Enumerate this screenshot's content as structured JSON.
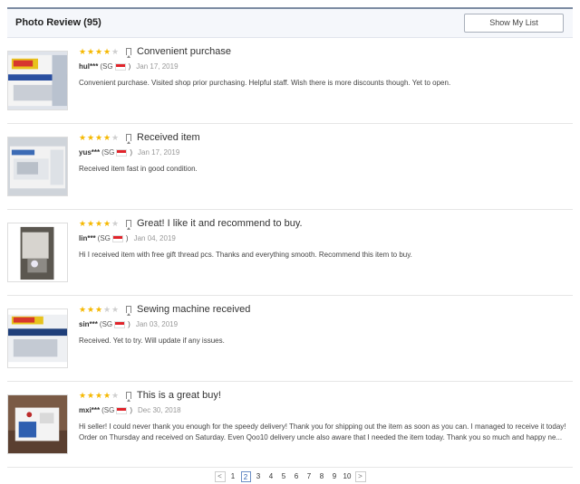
{
  "header": {
    "title": "Photo Review (95)",
    "show_list_label": "Show My List"
  },
  "reviews": [
    {
      "rating": 4,
      "title": "Convenient purchase",
      "user": "hul***",
      "country": "(SG",
      "date": "Jan 17, 2019",
      "text": "Convenient purchase. Visited shop prior purchasing. Helpful staff. Wish there is more discounts though. Yet to open."
    },
    {
      "rating": 4,
      "title": "Received item",
      "user": "yus***",
      "country": "(SG",
      "date": "Jan 17, 2019",
      "text": "Received item fast in good condition."
    },
    {
      "rating": 4,
      "title": "Great! I like it and recommend to buy.",
      "user": "lin***",
      "country": "(SG",
      "date": "Jan 04, 2019",
      "text": "Hi I received item with free gift thread pcs. Thanks and everything smooth. Recommend this item to buy."
    },
    {
      "rating": 3,
      "title": "Sewing machine received",
      "user": "sin***",
      "country": "(SG",
      "date": "Jan 03, 2019",
      "text": "Received. Yet to try. Will update if any issues."
    },
    {
      "rating": 4,
      "title": "This is a great buy!",
      "user": "mxi***",
      "country": "(SG",
      "date": "Dec 30, 2018",
      "text": "Hi seller! I could never thank you enough for the speedy delivery! Thank you for shipping out the item as soon as you can. I managed to receive it today! Order on Thursday and received on Saturday. Even Qoo10 delivery uncle also aware that I needed the item today. Thank you so much and happy ne..."
    }
  ],
  "pagination": {
    "prev": "<",
    "next": ">",
    "current": 2,
    "pages": [
      "1",
      "2",
      "3",
      "4",
      "5",
      "6",
      "7",
      "8",
      "9",
      "10"
    ]
  },
  "colors": {
    "star_on": "#f5b800",
    "star_off": "#cfcfcf",
    "header_border": "#7d8ca3",
    "current_page": "#2d5fb0"
  }
}
